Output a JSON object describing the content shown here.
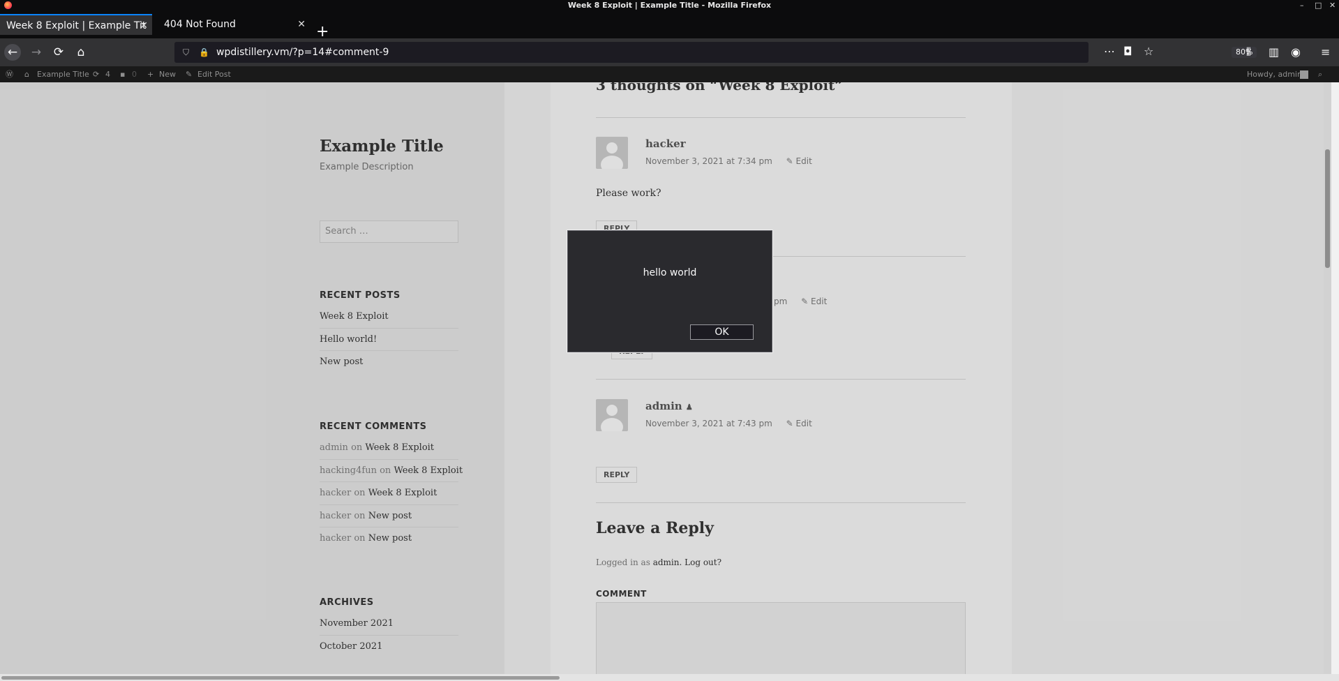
{
  "window": {
    "title": "Week 8 Exploit | Example Title - Mozilla Firefox",
    "controls": [
      "–",
      "□",
      "✕"
    ]
  },
  "tabs": [
    {
      "label": "Week 8 Exploit | Example Tit",
      "active": true
    },
    {
      "label": "404 Not Found",
      "active": false
    }
  ],
  "navbar": {
    "url": "wpdistillery.vm/?p=14#comment-9",
    "zoom": "80%"
  },
  "icons": {
    "back": "arrow-left-icon",
    "forward": "arrow-right-icon",
    "reload": "reload-icon",
    "home": "home-icon",
    "menu": "hamburger-menu-icon"
  },
  "adminbar": {
    "site_name": "Example Title",
    "updates_count": "4",
    "comments_count": "0",
    "new_label": "New",
    "edit_label": "Edit Post",
    "howdy": "Howdy, admin"
  },
  "sidebar": {
    "site_title": "Example Title",
    "site_description": "Example Description",
    "search_placeholder": "Search …",
    "recent_posts_title": "RECENT POSTS",
    "recent_posts": [
      "Week 8 Exploit",
      "Hello world!",
      "New post"
    ],
    "recent_comments_title": "RECENT COMMENTS",
    "recent_comments": [
      {
        "author": "admin",
        "on": "on",
        "post": "Week 8 Exploit"
      },
      {
        "author": "hacking4fun",
        "on": "on",
        "post": "Week 8 Exploit"
      },
      {
        "author": "hacker",
        "on": "on",
        "post": "Week 8 Exploit"
      },
      {
        "author": "hacker",
        "on": "on",
        "post": "New post"
      },
      {
        "author": "hacker",
        "on": "on",
        "post": "New post"
      }
    ],
    "archives_title": "ARCHIVES",
    "archives": [
      "November 2021",
      "October 2021"
    ]
  },
  "content": {
    "comments_heading": "3 thoughts on “Week 8 Exploit”",
    "comments": [
      {
        "author": "hacker",
        "date": "November 3, 2021 at 7:34 pm",
        "edit": "Edit",
        "text": "Please work?",
        "reply": "REPLY"
      },
      {
        "date_fragment": "pm",
        "edit": "Edit",
        "reply": "REPLY"
      },
      {
        "author": "admin",
        "date": "November 3, 2021 at 7:43 pm",
        "edit": "Edit",
        "reply": "REPLY"
      }
    ],
    "leave_reply": "Leave a Reply",
    "logged_in_prefix": "Logged in as",
    "logged_in_user": "admin.",
    "logout": "Log out?",
    "comment_label": "COMMENT"
  },
  "dialog": {
    "message": "hello world",
    "ok_label": "OK"
  }
}
